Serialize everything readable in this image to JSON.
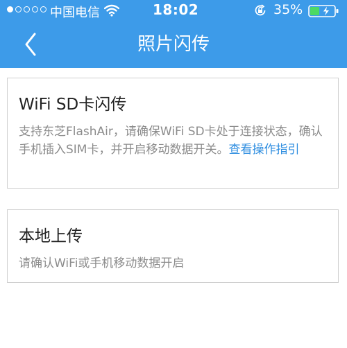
{
  "status_bar": {
    "carrier": "中国电信",
    "time": "18:02",
    "battery_percent": "35%",
    "signal_bars_filled": 1,
    "signal_bars_total": 5
  },
  "nav": {
    "title": "照片闪传",
    "back_icon": "chevron-left-icon"
  },
  "cards": {
    "wifi_sd": {
      "title": "WiFi SD卡闪传",
      "description": "支持东芝FlashAir，请确保WiFi SD卡处于连接状态，确认手机插入SIM卡，并开启移动数据开关。",
      "link_text": "查看操作指引"
    },
    "local_upload": {
      "title": "本地上传",
      "description": "请确认WiFi或手机移动数据开启"
    }
  },
  "colors": {
    "header_bg": "#3d9be9",
    "link": "#2f8ee0",
    "battery_fill": "#4cd964"
  }
}
